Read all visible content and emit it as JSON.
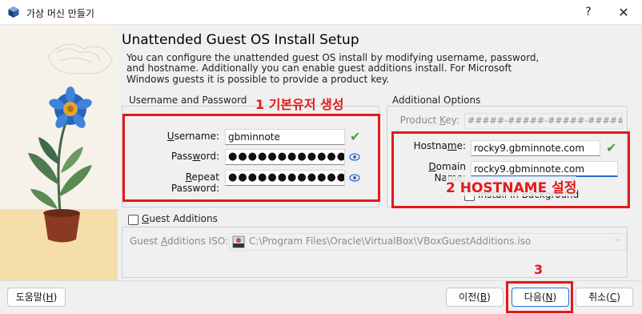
{
  "window": {
    "title": "가상 머신 만들기",
    "help": "?",
    "close": "✕"
  },
  "page": {
    "heading": "Unattended Guest OS Install Setup",
    "description": "You can configure the unattended guest OS install by modifying username, password, and hostname. Additionally you can enable guest additions install. For Microsoft Windows guests it is possible to provide a product key."
  },
  "credentials": {
    "group_label": "Username and Password",
    "username_label": "Username:",
    "username_value": "gbminnote",
    "password_label": "Password:",
    "password_value": "●●●●●●●●●●●●●",
    "repeat_label": "Repeat Password:",
    "repeat_value": "●●●●●●●●●●●●●"
  },
  "options": {
    "group_label": "Additional Options",
    "product_key_label": "Product Key:",
    "product_key_value": "#####-#####-#####-#####-#####",
    "hostname_label": "Hostname:",
    "hostname_value": "rocky9.gbminnote.com",
    "domain_label": "Domain Name:",
    "domain_value": "rocky9.gbminnote.com",
    "install_bg_label": "Install in Background"
  },
  "guest_additions": {
    "checkbox_label": "Guest Additions",
    "iso_label": "Guest Additions ISO:",
    "iso_path": "C:\\Program Files\\Oracle\\VirtualBox\\VBoxGuestAdditions.iso",
    "iso_badge": "ISO"
  },
  "annotations": {
    "a1": "1 기본유저 생성",
    "a2": "2  HOSTNAME 설정",
    "a3": "3",
    "color": "#e21a1a"
  },
  "footer": {
    "help": "도움말(H)",
    "back": "이전(B)",
    "next": "다음(N)",
    "cancel": "취소(C)"
  }
}
